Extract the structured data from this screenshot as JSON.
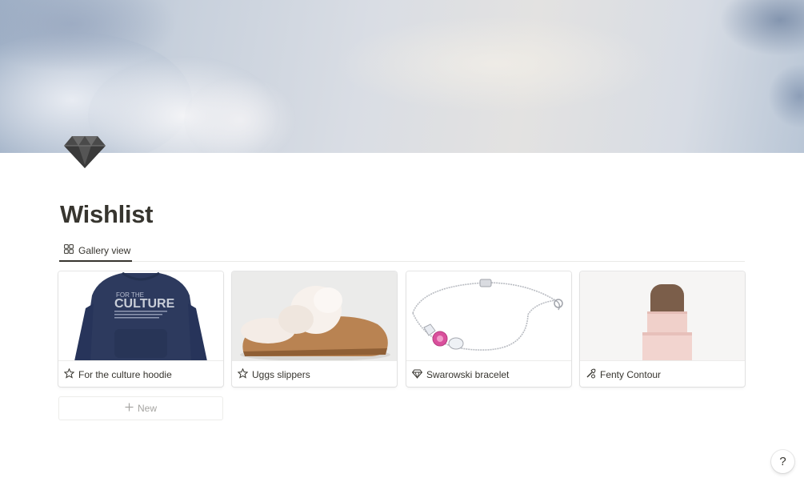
{
  "page": {
    "title": "Wishlist",
    "icon": "diamond-icon"
  },
  "views": [
    {
      "label": "Gallery view",
      "icon": "gallery-grid-icon",
      "active": true
    }
  ],
  "gallery": {
    "cards": [
      {
        "title": "For the culture hoodie",
        "icon": "star-icon",
        "image": "navy hoodie with graphic print",
        "print_line1": "FOR THE",
        "print_line2": "CULTURE"
      },
      {
        "title": "Uggs slippers",
        "icon": "star-icon",
        "image": "chestnut suede slippers with fluffy lining"
      },
      {
        "title": "Swarowski bracelet",
        "icon": "gem-icon",
        "image": "silver chain bracelet with pink and clear crystals"
      },
      {
        "title": "Fenty Contour",
        "icon": "makeup-brush-icon",
        "image": "pink contour stick"
      }
    ],
    "new_label": "New",
    "new_icon": "plus-icon"
  },
  "help": {
    "label": "?"
  },
  "colors": {
    "text": "#37352f",
    "muted": "#a5a4a1",
    "border": "#e9e9e7",
    "hoodie": "#2d3a5e",
    "slipper": "#b98352",
    "lipstick": "#f2d4cf"
  }
}
